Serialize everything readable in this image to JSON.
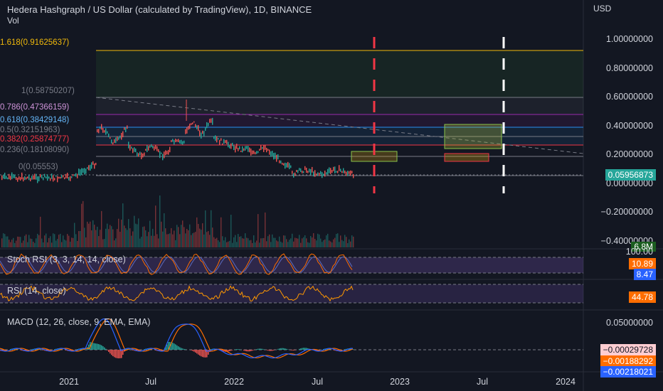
{
  "header": {
    "title": "Hedera Hashgraph / US Dollar (calculated by TradingView), 1D, BINANCE",
    "vol_label": "Vol",
    "currency": "USD"
  },
  "price_axis": {
    "ticks": [
      "1.00000000",
      "0.80000000",
      "0.60000000",
      "0.40000000",
      "0.20000000",
      "0.00000000",
      "−0.20000000",
      "−0.40000000"
    ],
    "last_price": "0.05956873",
    "last_price_color": "#26a69a"
  },
  "fib_levels": [
    {
      "label": "1.618(0.91625637)",
      "color": "#f0b90b"
    },
    {
      "label": "1(0.58750207)",
      "color": "#787b86"
    },
    {
      "label": "0.786(0.47366159)",
      "color": "#9c27b0"
    },
    {
      "label": "0.618(0.38429148)",
      "color": "#2196f3"
    },
    {
      "label": "0.5(0.32151963)",
      "color": "#787b86"
    },
    {
      "label": "0.382(0.25874777)",
      "color": "#f23645"
    },
    {
      "label": "0.236(0.18108090)",
      "color": "#787b86"
    },
    {
      "label": "0(0.05553)",
      "color": "#787b86"
    }
  ],
  "volume_pane": {
    "value": "6.8M",
    "color": "#26a69a"
  },
  "stoch_rsi": {
    "title": "Stoch RSI (3, 3, 14, 14, close)",
    "top_tick": "100.00",
    "k_value": "10.89",
    "d_value": "8.47",
    "k_color": "#ff6d00",
    "d_color": "#2962ff"
  },
  "rsi": {
    "title": "RSI (14, close)",
    "value": "44.78",
    "color": "#ff6d00"
  },
  "macd": {
    "title": "MACD (12, 26, close, 9, EMA, EMA)",
    "tick": "0.05000000",
    "histogram_value": "−0.00029728",
    "signal_value": "−0.00188292",
    "macd_value": "−0.00218021",
    "hist_color": "#ffcdd2",
    "signal_color": "#ff6d00",
    "macd_color": "#2962ff"
  },
  "time_axis": {
    "labels": [
      "2021",
      "Jul",
      "2022",
      "Jul",
      "2023",
      "Jul",
      "2024"
    ]
  }
}
